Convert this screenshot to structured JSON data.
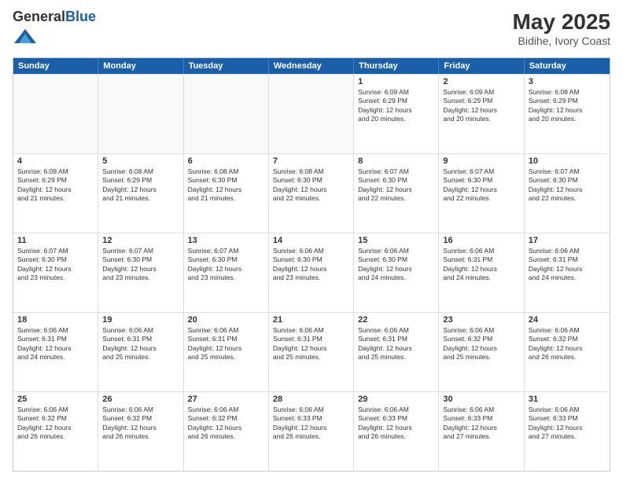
{
  "header": {
    "logo_general": "General",
    "logo_blue": "Blue",
    "title": "May 2025",
    "subtitle": "Bidihe, Ivory Coast"
  },
  "calendar": {
    "days": [
      "Sunday",
      "Monday",
      "Tuesday",
      "Wednesday",
      "Thursday",
      "Friday",
      "Saturday"
    ],
    "rows": [
      [
        {
          "day": "",
          "text": ""
        },
        {
          "day": "",
          "text": ""
        },
        {
          "day": "",
          "text": ""
        },
        {
          "day": "",
          "text": ""
        },
        {
          "day": "1",
          "text": "Sunrise: 6:09 AM\nSunset: 6:29 PM\nDaylight: 12 hours\nand 20 minutes."
        },
        {
          "day": "2",
          "text": "Sunrise: 6:09 AM\nSunset: 6:29 PM\nDaylight: 12 hours\nand 20 minutes."
        },
        {
          "day": "3",
          "text": "Sunrise: 6:08 AM\nSunset: 6:29 PM\nDaylight: 12 hours\nand 20 minutes."
        }
      ],
      [
        {
          "day": "4",
          "text": "Sunrise: 6:08 AM\nSunset: 6:29 PM\nDaylight: 12 hours\nand 21 minutes."
        },
        {
          "day": "5",
          "text": "Sunrise: 6:08 AM\nSunset: 6:29 PM\nDaylight: 12 hours\nand 21 minutes."
        },
        {
          "day": "6",
          "text": "Sunrise: 6:08 AM\nSunset: 6:30 PM\nDaylight: 12 hours\nand 21 minutes."
        },
        {
          "day": "7",
          "text": "Sunrise: 6:08 AM\nSunset: 6:30 PM\nDaylight: 12 hours\nand 22 minutes."
        },
        {
          "day": "8",
          "text": "Sunrise: 6:07 AM\nSunset: 6:30 PM\nDaylight: 12 hours\nand 22 minutes."
        },
        {
          "day": "9",
          "text": "Sunrise: 6:07 AM\nSunset: 6:30 PM\nDaylight: 12 hours\nand 22 minutes."
        },
        {
          "day": "10",
          "text": "Sunrise: 6:07 AM\nSunset: 6:30 PM\nDaylight: 12 hours\nand 22 minutes."
        }
      ],
      [
        {
          "day": "11",
          "text": "Sunrise: 6:07 AM\nSunset: 6:30 PM\nDaylight: 12 hours\nand 23 minutes."
        },
        {
          "day": "12",
          "text": "Sunrise: 6:07 AM\nSunset: 6:30 PM\nDaylight: 12 hours\nand 23 minutes."
        },
        {
          "day": "13",
          "text": "Sunrise: 6:07 AM\nSunset: 6:30 PM\nDaylight: 12 hours\nand 23 minutes."
        },
        {
          "day": "14",
          "text": "Sunrise: 6:06 AM\nSunset: 6:30 PM\nDaylight: 12 hours\nand 23 minutes."
        },
        {
          "day": "15",
          "text": "Sunrise: 6:06 AM\nSunset: 6:30 PM\nDaylight: 12 hours\nand 24 minutes."
        },
        {
          "day": "16",
          "text": "Sunrise: 6:06 AM\nSunset: 6:31 PM\nDaylight: 12 hours\nand 24 minutes."
        },
        {
          "day": "17",
          "text": "Sunrise: 6:06 AM\nSunset: 6:31 PM\nDaylight: 12 hours\nand 24 minutes."
        }
      ],
      [
        {
          "day": "18",
          "text": "Sunrise: 6:06 AM\nSunset: 6:31 PM\nDaylight: 12 hours\nand 24 minutes."
        },
        {
          "day": "19",
          "text": "Sunrise: 6:06 AM\nSunset: 6:31 PM\nDaylight: 12 hours\nand 25 minutes."
        },
        {
          "day": "20",
          "text": "Sunrise: 6:06 AM\nSunset: 6:31 PM\nDaylight: 12 hours\nand 25 minutes."
        },
        {
          "day": "21",
          "text": "Sunrise: 6:06 AM\nSunset: 6:31 PM\nDaylight: 12 hours\nand 25 minutes."
        },
        {
          "day": "22",
          "text": "Sunrise: 6:06 AM\nSunset: 6:31 PM\nDaylight: 12 hours\nand 25 minutes."
        },
        {
          "day": "23",
          "text": "Sunrise: 6:06 AM\nSunset: 6:32 PM\nDaylight: 12 hours\nand 25 minutes."
        },
        {
          "day": "24",
          "text": "Sunrise: 6:06 AM\nSunset: 6:32 PM\nDaylight: 12 hours\nand 26 minutes."
        }
      ],
      [
        {
          "day": "25",
          "text": "Sunrise: 6:06 AM\nSunset: 6:32 PM\nDaylight: 12 hours\nand 26 minutes."
        },
        {
          "day": "26",
          "text": "Sunrise: 6:06 AM\nSunset: 6:32 PM\nDaylight: 12 hours\nand 26 minutes."
        },
        {
          "day": "27",
          "text": "Sunrise: 6:06 AM\nSunset: 6:32 PM\nDaylight: 12 hours\nand 26 minutes."
        },
        {
          "day": "28",
          "text": "Sunrise: 6:06 AM\nSunset: 6:33 PM\nDaylight: 12 hours\nand 26 minutes."
        },
        {
          "day": "29",
          "text": "Sunrise: 6:06 AM\nSunset: 6:33 PM\nDaylight: 12 hours\nand 26 minutes."
        },
        {
          "day": "30",
          "text": "Sunrise: 6:06 AM\nSunset: 6:33 PM\nDaylight: 12 hours\nand 27 minutes."
        },
        {
          "day": "31",
          "text": "Sunrise: 6:06 AM\nSunset: 6:33 PM\nDaylight: 12 hours\nand 27 minutes."
        }
      ]
    ]
  }
}
